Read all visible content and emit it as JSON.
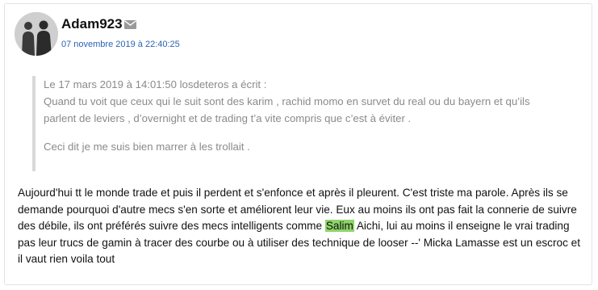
{
  "author": {
    "username": "Adam923",
    "date": "07 novembre 2019 à 22:40:25",
    "avatar_icon": "user-silhouette-avatar",
    "mail_icon": "envelope-icon"
  },
  "quote": {
    "header": "Le 17 mars 2019 à 14:01:50 losdeteros a écrit :",
    "line1": "Quand tu voit que ceux qui le suit sont des karim , rachid momo en survet du real ou du bayern et qu’ils",
    "line2": "parlent de leviers , d’overnight et de trading t’a vite compris que c’est à éviter .",
    "line3": "Ceci dit je me suis bien marrer à les trollait ."
  },
  "body": {
    "text_before": "Aujourd'hui tt le monde trade et puis il perdent et s'enfonce et après il pleurent. C'est triste ma parole. Après ils se demande pourquoi d'autre mecs s'en sorte et améliorent leur vie. Eux au moins ils ont pas fait la connerie de suivre des débile, ils ont préférés suivre des mecs intelligents comme ",
    "highlighted": "Salim",
    "text_after": " Aichi, lui au moins il enseigne le vrai trading pas leur trucs de gamin à tracer des courbe ou à utiliser des technique de looser --' Micka Lamasse est un escroc et il vaut rien voila tout"
  },
  "colors": {
    "date_link": "#2a64b4",
    "quote_text": "#8a8a8a",
    "quote_border": "#d8d8d8",
    "highlight": "#8ed46a"
  }
}
